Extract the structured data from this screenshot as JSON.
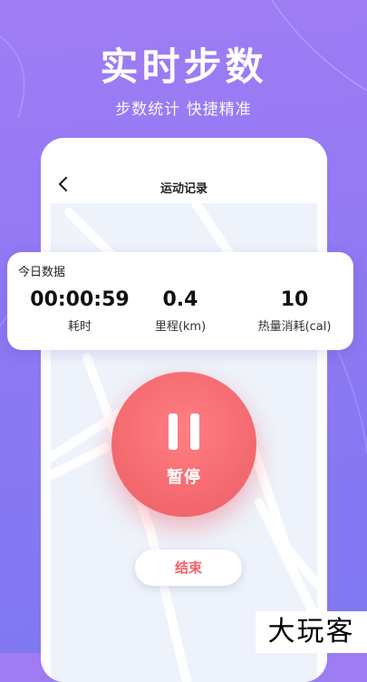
{
  "headline": "实时步数",
  "subline": "步数统计 快捷精准",
  "screen": {
    "back_icon": "chevron-left-icon",
    "title": "运动记录"
  },
  "stats": {
    "title": "今日数据",
    "items": [
      {
        "value": "00:00:59",
        "label": "耗时"
      },
      {
        "value": "0.4",
        "label": "里程(km)"
      },
      {
        "value": "10",
        "label": "热量消耗(cal)"
      }
    ]
  },
  "controls": {
    "pause_label": "暂停",
    "end_label": "结束"
  },
  "watermark": "大玩客",
  "colors": {
    "background_top": "#a07cf4",
    "background_bottom": "#7f78f1",
    "accent": "#f46a70"
  }
}
